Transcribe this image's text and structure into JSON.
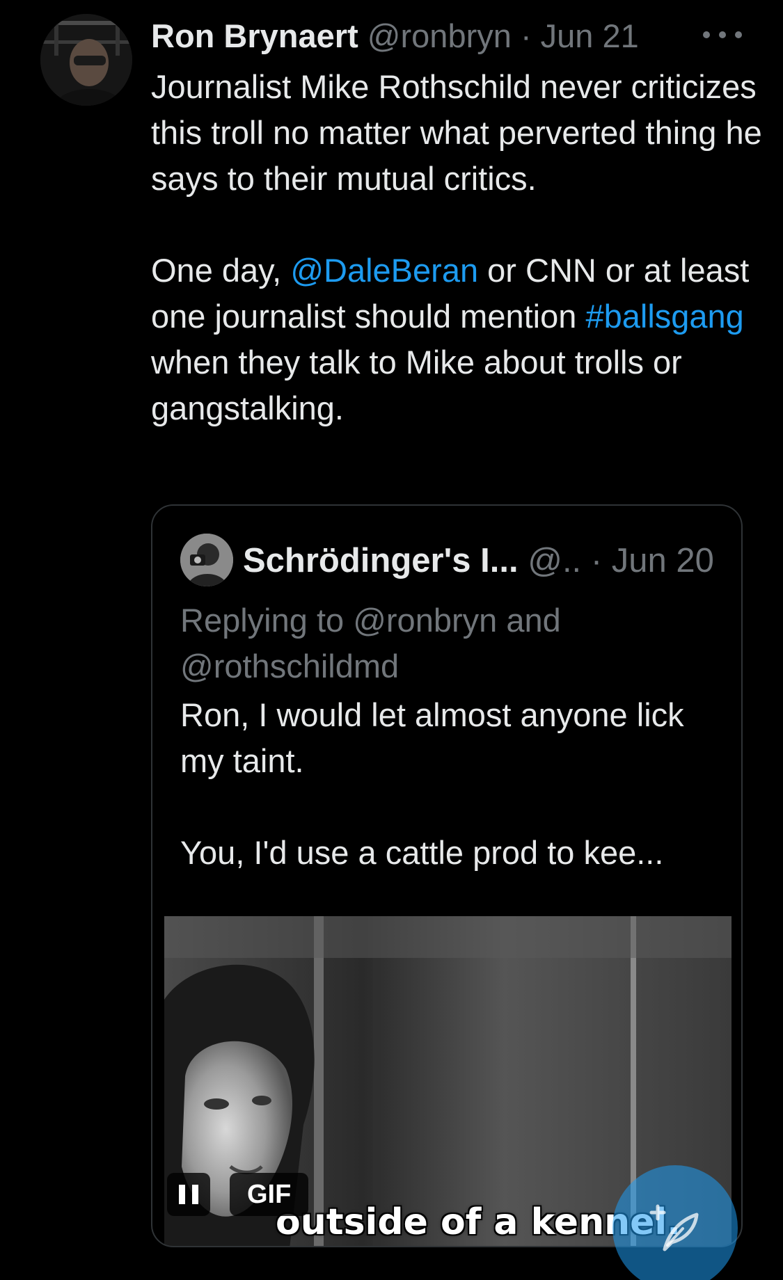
{
  "tweet": {
    "author_name": "Ron Brynaert",
    "author_handle": "@ronbryn",
    "separator": "·",
    "date": "Jun 21",
    "text_p1": "Journalist Mike Rothschild never criticizes this troll no matter what perverted thing he says to their mutual critics.",
    "text_p2_part1": "One day, ",
    "text_p2_mention": "@DaleBeran",
    "text_p2_part2": " or CNN or at least one journalist should mention ",
    "text_p2_hashtag": "#ballsgang",
    "text_p2_part3": " when they talk to Mike about trolls or gangstalking."
  },
  "quote": {
    "author_name": "Schrödinger's I...",
    "author_handle": "@..",
    "separator": "·",
    "date": "Jun 20",
    "replying_to": "Replying to @ronbryn and @rothschildmd",
    "text_p1": "Ron, I would let almost anyone lick my taint.",
    "text_p2": "You, I'd use a cattle prod to kee...",
    "media": {
      "caption": "outside of a kennel.",
      "badge": "GIF"
    }
  },
  "icons": {
    "more": "more-horizontal-icon",
    "pause": "pause-icon",
    "compose": "feather-plus-icon"
  },
  "colors": {
    "background": "#000000",
    "text": "#e7e9ea",
    "secondary_text": "#71767b",
    "link": "#1d9bf0",
    "border": "#2f3336"
  }
}
